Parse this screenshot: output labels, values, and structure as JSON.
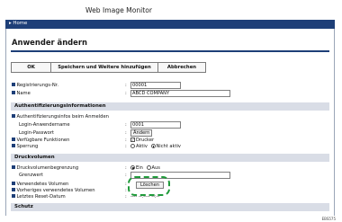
{
  "header": {
    "app_title": "Web Image Monitor",
    "home_link": "Home"
  },
  "page": {
    "title": "Anwender ändern"
  },
  "toolbar": {
    "ok": "OK",
    "save_and_add": "Speichern und Weitere hinzufügen",
    "cancel": "Abbrechen"
  },
  "fields": {
    "registration_no_label": "Registrierungs-Nr.",
    "registration_no_value": "00001",
    "name_label": "Name",
    "name_value": "ABCD COMPANY"
  },
  "auth_section": {
    "title": "Authentifizierungsinformationen",
    "login_info_label": "Authentifizierungsinfos beim Anmelden",
    "login_user_label": "Login-Anwendername",
    "login_user_value": "0001",
    "login_pw_label": "Login-Passwort",
    "change_button": "Ändern",
    "functions_label": "Verfügbare Funktionen",
    "printer_option": "Drucker",
    "lock_label": "Sperrung",
    "active_option": "Aktiv",
    "inactive_option": "Nicht aktiv"
  },
  "volume_section": {
    "title": "Druckvolumen",
    "limit_label": "Druckvolumenbegrenzung",
    "on_option": "Ein",
    "off_option": "Aus",
    "threshold_label": "Grenzwert",
    "used_label": "Verwendetes Volumen",
    "delete_button": "Löschen",
    "prev_used_label": "Vorheriges verwendetes Volumen",
    "last_reset_label": "Letztes Reset-Datum",
    "last_reset_value": "---- --.---- --:--"
  },
  "protection_section": {
    "title": "Schutz"
  },
  "footer": {
    "figure_code": "EBS575"
  }
}
